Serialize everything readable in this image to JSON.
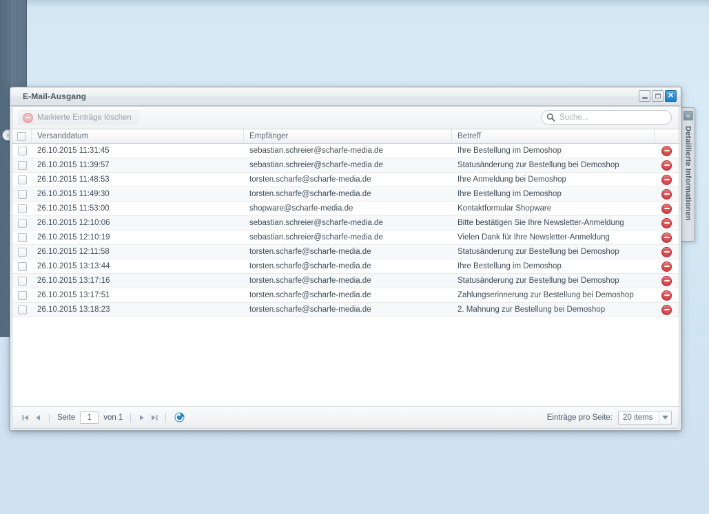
{
  "window": {
    "title": "E-Mail-Ausgang",
    "controls": {
      "minimize": "minimize",
      "maximize": "maximize",
      "close": "✕"
    }
  },
  "toolbar": {
    "delete_selected_label": "Markierte Einträge löschen",
    "search_placeholder": "Suche...",
    "search_value": ""
  },
  "grid": {
    "columns": [
      {
        "key": "check",
        "label": ""
      },
      {
        "key": "date",
        "label": "Versanddatum"
      },
      {
        "key": "mail",
        "label": "Empfänger"
      },
      {
        "key": "subject",
        "label": "Betreff"
      },
      {
        "key": "action",
        "label": ""
      }
    ],
    "rows": [
      {
        "date": "26.10.2015 11:31:45",
        "mail": "sebastian.schreier@scharfe-media.de",
        "subject": "Ihre Bestellung im Demoshop"
      },
      {
        "date": "26.10.2015 11:39:57",
        "mail": "sebastian.schreier@scharfe-media.de",
        "subject": "Statusänderung zur Bestellung bei Demoshop"
      },
      {
        "date": "26.10.2015 11:48:53",
        "mail": "torsten.scharfe@scharfe-media.de",
        "subject": "Ihre Anmeldung bei Demoshop"
      },
      {
        "date": "26.10.2015 11:49:30",
        "mail": "torsten.scharfe@scharfe-media.de",
        "subject": "Ihre Bestellung im Demoshop"
      },
      {
        "date": "26.10.2015 11:53:00",
        "mail": "shopware@scharfe-media.de",
        "subject": "Kontaktformular Shopware"
      },
      {
        "date": "26.10.2015 12:10:06",
        "mail": "sebastian.schreier@scharfe-media.de",
        "subject": "Bitte bestätigen Sie Ihre Newsletter-Anmeldung"
      },
      {
        "date": "26.10.2015 12:10:19",
        "mail": "sebastian.schreier@scharfe-media.de",
        "subject": "Vielen Dank für Ihre Newsletter-Anmeldung"
      },
      {
        "date": "26.10.2015 12:11:58",
        "mail": "torsten.scharfe@scharfe-media.de",
        "subject": "Statusänderung zur Bestellung bei Demoshop"
      },
      {
        "date": "26.10.2015 13:13:44",
        "mail": "torsten.scharfe@scharfe-media.de",
        "subject": "Ihre Bestellung im Demoshop"
      },
      {
        "date": "26.10.2015 13:17:16",
        "mail": "torsten.scharfe@scharfe-media.de",
        "subject": "Statusänderung zur Bestellung bei Demoshop"
      },
      {
        "date": "26.10.2015 13:17:51",
        "mail": "torsten.scharfe@scharfe-media.de",
        "subject": "Zahlungserinnerung zur Bestellung bei Demoshop"
      },
      {
        "date": "26.10.2015 13:18:23",
        "mail": "torsten.scharfe@scharfe-media.de",
        "subject": "2. Mahnung zur Bestellung bei Demoshop"
      }
    ]
  },
  "paging": {
    "first_label": "first-page",
    "prev_label": "previous-page",
    "page_word": "Seite",
    "page_value": "1",
    "of_text": "von 1",
    "next_label": "next-page",
    "last_label": "last-page",
    "refresh_label": "refresh",
    "per_page_label": "Einträge pro Seite:",
    "per_page_value": "20 items"
  },
  "detail_panel": {
    "label": "Detaillierte Informationen",
    "collapse_glyph": "«"
  },
  "left_rail": {
    "expand_glyph": "›"
  },
  "colors": {
    "accent_blue": "#1b7fc4",
    "delete_red": "#c8383c",
    "refresh_blue": "#1f86c9",
    "header_text": "#5c6874",
    "row_text": "#3f4c59",
    "background": "#d6e9f5"
  }
}
